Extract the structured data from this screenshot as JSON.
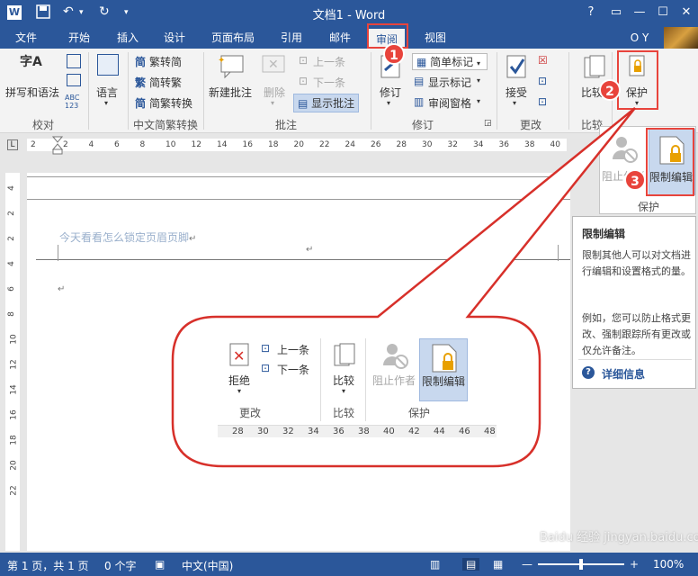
{
  "window": {
    "title": "文档1 - Word",
    "help": "?",
    "restore": "▭",
    "minimize": "—",
    "maximize": "☐",
    "close": "✕"
  },
  "tabs": [
    "文件",
    "开始",
    "插入",
    "设计",
    "页面布局",
    "引用",
    "邮件",
    "审阅",
    "视图"
  ],
  "user": "O Y",
  "ribbon": {
    "proofing": {
      "spell": "拼写和语法",
      "label": "校对"
    },
    "language": {
      "lang": "语言"
    },
    "chinese": {
      "t2s": "繁转简",
      "s2t": "简转繁",
      "convert": "简繁转换",
      "label": "中文简繁转换"
    },
    "comments": {
      "new": "新建批注",
      "delete": "删除",
      "prev": "上一条",
      "next": "下一条",
      "show": "显示批注",
      "label": "批注"
    },
    "tracking": {
      "track": "修订",
      "markup": "简单标记",
      "show_markup": "显示标记",
      "pane": "审阅窗格",
      "label": "修订"
    },
    "changes": {
      "accept": "接受",
      "label": "更改"
    },
    "compare": {
      "compare": "比较",
      "label": "比较"
    },
    "protect": {
      "protect": "保护"
    }
  },
  "protect_dropdown": {
    "block": "阻止作者",
    "restrict": "限制编辑",
    "label": "保护"
  },
  "tooltip": {
    "title": "限制编辑",
    "body1": "限制其他人可以对文档进行编辑和设置格式的量。",
    "body2": "例如，您可以防止格式更改、强制跟踪所有更改或仅允许备注。",
    "more": "详细信息"
  },
  "ruler_numbers": [
    "2",
    "2",
    "4",
    "6",
    "8",
    "10",
    "12",
    "14",
    "16",
    "18",
    "20",
    "22",
    "24",
    "26",
    "28",
    "30",
    "32",
    "34",
    "36",
    "38",
    "40"
  ],
  "vruler_numbers": [
    "4",
    "2",
    "2",
    "4",
    "6",
    "8",
    "10",
    "12",
    "14",
    "16",
    "18",
    "20",
    "22"
  ],
  "document": {
    "header_text": "今天看看怎么锁定页眉页脚",
    "mark": "↵"
  },
  "callout": {
    "prev": "上一条",
    "next": "下一条",
    "reject": "拒绝",
    "compare": "比较",
    "block": "阻止作者",
    "restrict": "限制编辑",
    "group_changes": "更改",
    "group_compare": "比较",
    "group_protect": "保护",
    "ruler": [
      "28",
      "30",
      "32",
      "34",
      "36",
      "38",
      "40",
      "42",
      "44",
      "46",
      "48"
    ]
  },
  "badges": [
    "1",
    "2",
    "3"
  ],
  "status": {
    "page": "第 1 页，共 1 页",
    "words": "0 个字",
    "lang": "中文(中国)",
    "zoom": "100%"
  },
  "watermark": "Baidu 经验 jingyan.baidu.com",
  "colors": {
    "word_blue": "#2b579a",
    "highlight": "#e8443c"
  }
}
